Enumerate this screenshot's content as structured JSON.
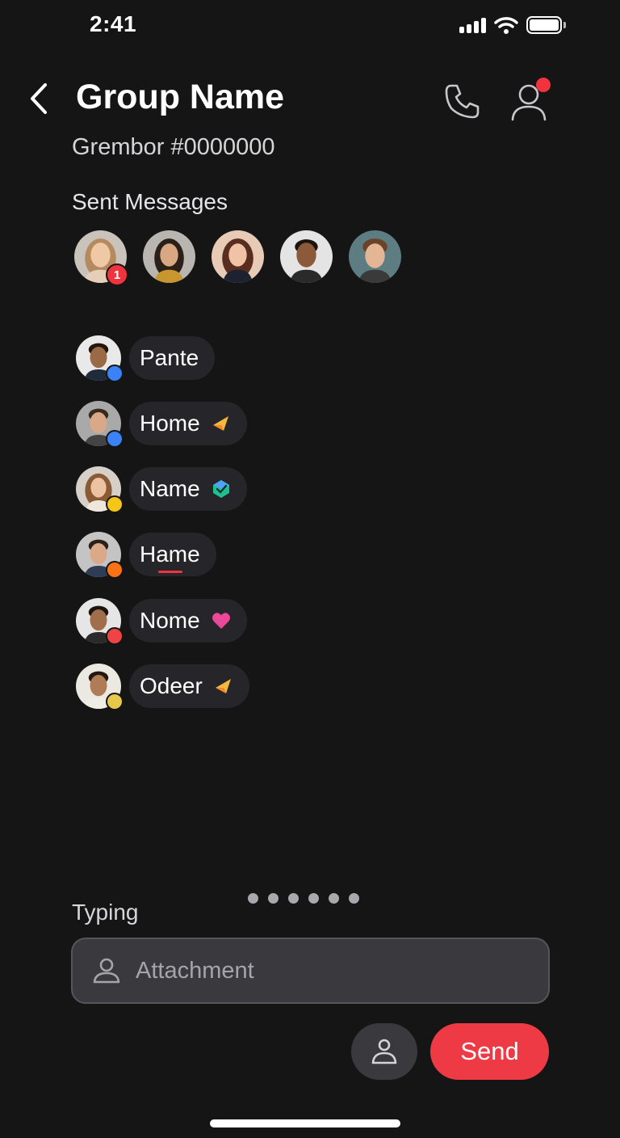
{
  "status_bar": {
    "time": "2:41"
  },
  "header": {
    "title": "Group Name",
    "subtitle": "Grembor #0000000"
  },
  "sent": {
    "label": "Sent Messages",
    "avatars": [
      {
        "name": "avatar-1",
        "badge": "1"
      },
      {
        "name": "avatar-2"
      },
      {
        "name": "avatar-3"
      },
      {
        "name": "avatar-4"
      },
      {
        "name": "avatar-5"
      }
    ]
  },
  "members": [
    {
      "label": "Pante",
      "status_color": "#3b82f6",
      "icon": "none"
    },
    {
      "label": "Home",
      "status_color": "#3b82f6",
      "icon": "send-arrow-icon"
    },
    {
      "label": "Name",
      "status_color": "#f5c518",
      "icon": "verified-badge-icon"
    },
    {
      "label": "Hame",
      "status_color": "#f97316",
      "icon": "underline-mark"
    },
    {
      "label": "Nome",
      "status_color": "#ef4444",
      "icon": "heart-icon"
    },
    {
      "label": "Odeer",
      "status_color": "#e6c84b",
      "icon": "send-arrow-icon"
    }
  ],
  "composer": {
    "typing_label": "Typing",
    "placeholder": "Attachment",
    "send_label": "Send",
    "page_dots": 6
  },
  "colors": {
    "background": "#151516",
    "accent_red": "#ee3a44",
    "chip": "#26262a",
    "input": "#3a3a3e"
  }
}
